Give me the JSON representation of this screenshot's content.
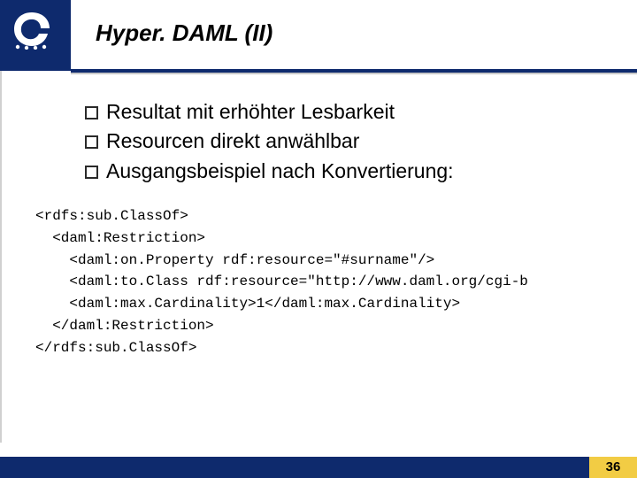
{
  "title": "Hyper. DAML (II)",
  "bullets": [
    "Resultat mit erhöhter Lesbarkeit",
    "Resourcen direkt anwählbar",
    "Ausgangsbeispiel nach Konvertierung:"
  ],
  "code_lines": [
    "<rdfs:sub.ClassOf>",
    "  <daml:Restriction>",
    "    <daml:on.Property rdf:resource=\"#surname\"/>",
    "    <daml:to.Class rdf:resource=\"http://www.daml.org/cgi-b",
    "    <daml:max.Cardinality>1</daml:max.Cardinality>",
    "  </daml:Restriction>",
    "</rdfs:sub.ClassOf>"
  ],
  "page_number": "36"
}
